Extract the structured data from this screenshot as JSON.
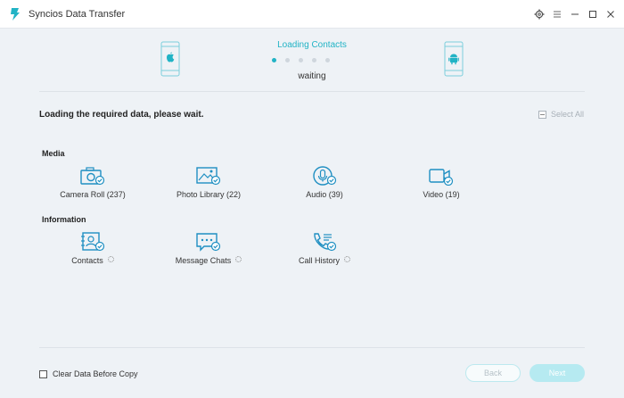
{
  "app": {
    "title": "Syncios Data Transfer"
  },
  "transfer": {
    "status_title": "Loading Contacts",
    "status_sub": "waiting",
    "source_device": "ios-phone-icon",
    "target_device": "android-phone-icon",
    "progress_step": 1,
    "progress_total": 5
  },
  "main": {
    "loading_message": "Loading the required data, please wait.",
    "select_all_label": "Select All"
  },
  "media": {
    "heading": "Media",
    "items": [
      {
        "label": "Camera Roll (237)",
        "icon": "camera-icon"
      },
      {
        "label": "Photo Library (22)",
        "icon": "photo-icon"
      },
      {
        "label": "Audio (39)",
        "icon": "microphone-icon"
      },
      {
        "label": "Video (19)",
        "icon": "video-icon"
      }
    ]
  },
  "information": {
    "heading": "Information",
    "items": [
      {
        "label": "Contacts",
        "icon": "contacts-icon",
        "loading": true
      },
      {
        "label": "Message Chats",
        "icon": "message-icon",
        "loading": true
      },
      {
        "label": "Call History",
        "icon": "call-history-icon",
        "loading": true
      }
    ]
  },
  "footer": {
    "clear_data_label": "Clear Data Before Copy",
    "back_label": "Back",
    "next_label": "Next"
  },
  "colors": {
    "accent": "#21b3c5",
    "background": "#eef2f6",
    "button_disabled": "#b6eaf1"
  }
}
